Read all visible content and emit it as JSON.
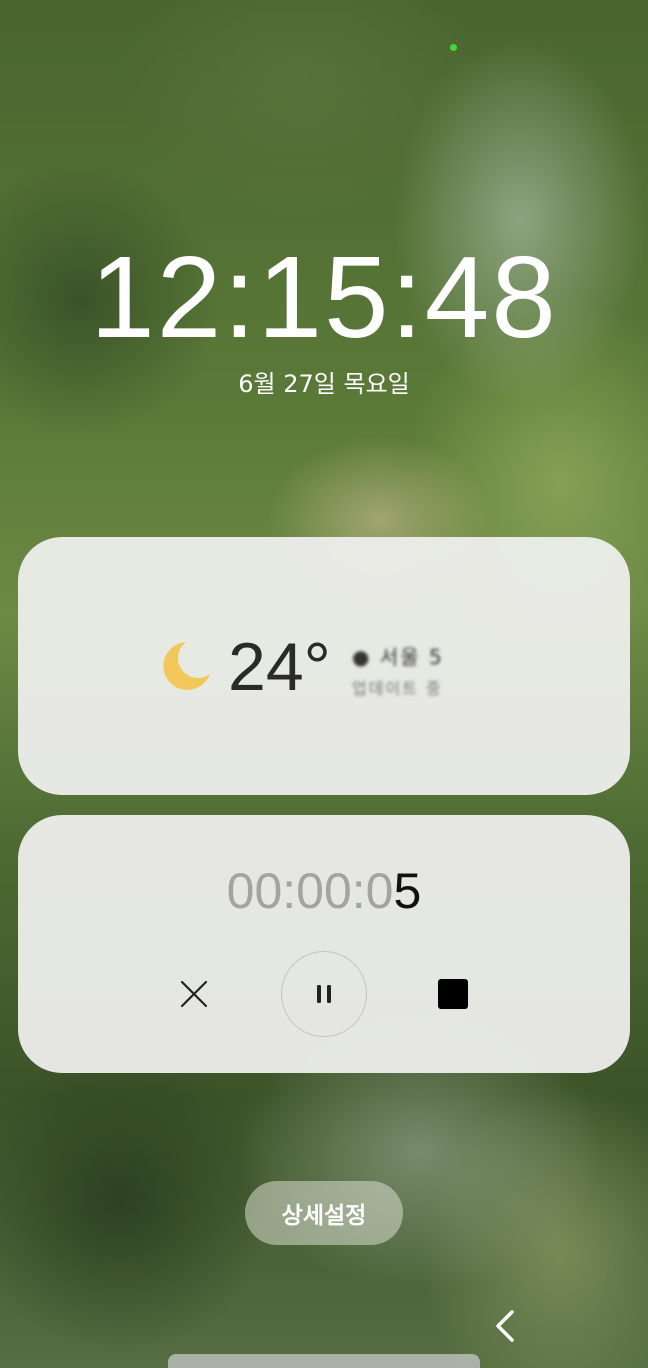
{
  "lockscreen": {
    "time": "12:15:48",
    "date": "6월 27일 목요일"
  },
  "weather": {
    "icon": "moon-icon",
    "temperature": "24°",
    "location_line1": "● 서울 5",
    "location_line2": "업데이트 중"
  },
  "stopwatch": {
    "elapsed_dim": "00:00:0",
    "elapsed_live": "5",
    "controls": {
      "close": "close-icon",
      "pause": "pause-icon",
      "stop": "stop-icon"
    }
  },
  "footer": {
    "settings_label": "상세설정"
  },
  "colors": {
    "moon": "#f3c85a",
    "indicator": "#3ed93a",
    "text_dim": "#a3a3a3"
  }
}
